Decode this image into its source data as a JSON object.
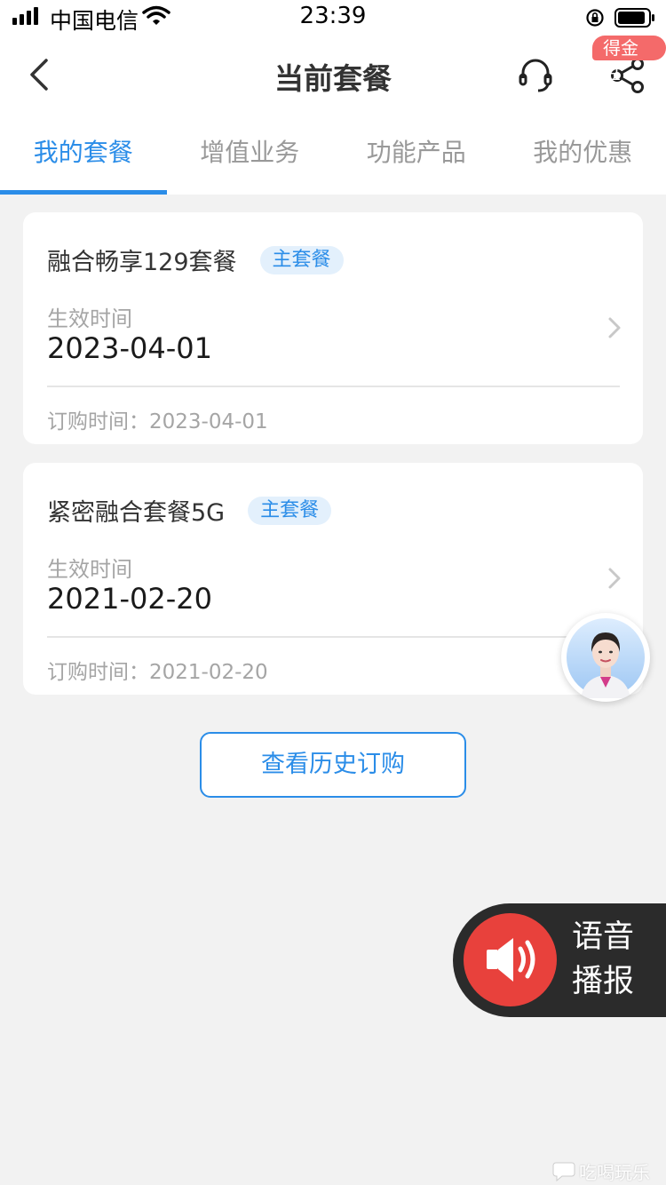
{
  "status_bar": {
    "carrier": "中国电信",
    "time": "23:39"
  },
  "nav": {
    "title": "当前套餐",
    "badge": "得金豆",
    "icons": [
      "back-icon",
      "headset-icon",
      "share-icon"
    ]
  },
  "tabs": [
    {
      "label": "我的套餐",
      "active": true
    },
    {
      "label": "增值业务",
      "active": false
    },
    {
      "label": "功能产品",
      "active": false
    },
    {
      "label": "我的优惠",
      "active": false
    }
  ],
  "packages": [
    {
      "name": "融合畅享129套餐",
      "tag": "主套餐",
      "effective_label": "生效时间",
      "effective_date": "2023-04-01",
      "order_label": "订购时间：",
      "order_date": "2023-04-01"
    },
    {
      "name": "紧密融合套餐5G",
      "tag": "主套餐",
      "effective_label": "生效时间",
      "effective_date": "2021-02-20",
      "order_label": "订购时间：",
      "order_date": "2021-02-20"
    }
  ],
  "history_button": "查看历史订购",
  "voice": {
    "line1": "语音",
    "line2": "播报"
  },
  "watermark": "吃喝玩乐网",
  "colors": {
    "accent": "#2b8de8",
    "badge": "#f46a6a",
    "voice_bg": "#2b2b2b",
    "voice_button": "#e8413c"
  }
}
